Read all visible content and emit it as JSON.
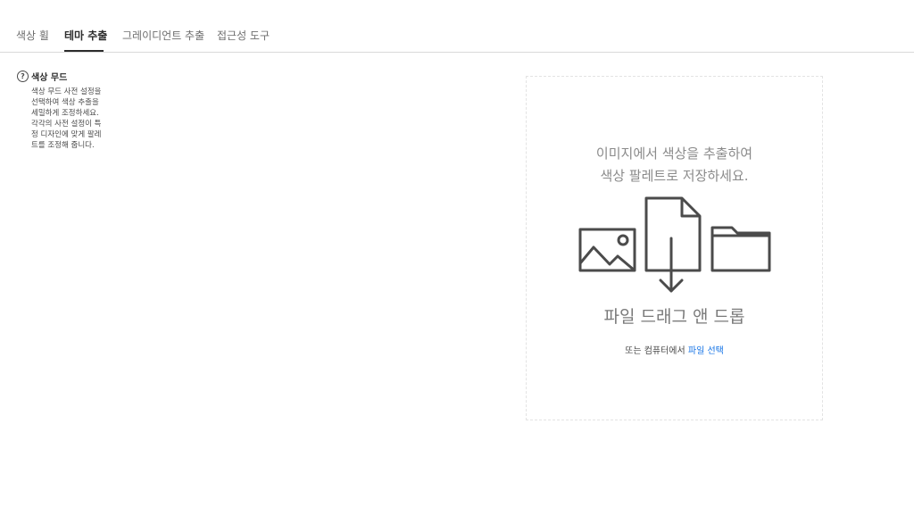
{
  "tabs": [
    {
      "label": "색상 휠",
      "active": false
    },
    {
      "label": "테마 추출",
      "active": true
    },
    {
      "label": "그레이디언트 추출",
      "active": false
    },
    {
      "label": "접근성 도구",
      "active": false
    }
  ],
  "help": {
    "icon": "question-circle-icon",
    "icon_glyph": "?",
    "title": "색상 무드",
    "description_lines": [
      "색상 무드 사전 설정을",
      "선택하여 색상 추출을",
      "세밀하게 조정하세요.",
      "각각의 사전 설정이 특",
      "정 디자인에 맞게 팔레",
      "트를 조정해 줍니다."
    ]
  },
  "dropzone": {
    "heading_lines": [
      "이미지에서 색상을 추출하여",
      "색상 팔레트로 저장하세요."
    ],
    "icons": [
      "image-icon",
      "document-icon",
      "download-arrow-icon",
      "folder-icon"
    ],
    "drag_title": "파일 드래그 앤 드롭",
    "or_text": "또는 컴퓨터에서 ",
    "select_link": "파일 선택"
  },
  "colors": {
    "accent_link": "#1473e6",
    "icon_stroke": "#4b4b4b",
    "text_primary": "#2c2c2c",
    "text_muted": "#8a8a8a"
  }
}
